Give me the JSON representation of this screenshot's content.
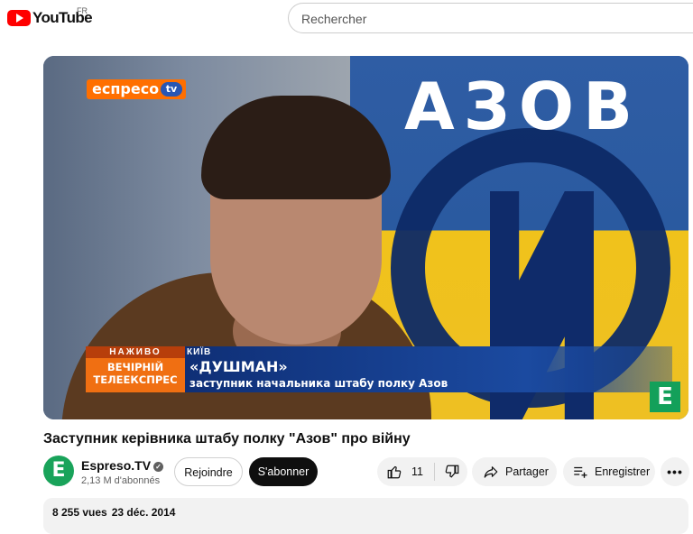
{
  "header": {
    "logo_text": "YouTube",
    "region": "FR",
    "search_placeholder": "Rechercher"
  },
  "player": {
    "brand_tag": "еспресо",
    "brand_tag_tv": "tv",
    "flag_text": "АЗОВ",
    "lower_third": {
      "live_label": "НАЖИВО",
      "show_name_line1": "ВЕЧІРНІЙ",
      "show_name_line2": "ТЕЛЕЕКСПРЕС",
      "city": "КИЇВ",
      "guest_name": "«ДУШМАН»",
      "guest_role": "заступник начальника штабу полку Азов"
    },
    "corner_logo": "Е"
  },
  "video": {
    "title": "Заступник керівника штабу полку \"Азов\" про війну",
    "views": "8 255 vues",
    "date": "23 déc. 2014"
  },
  "channel": {
    "avatar_letter": "Е",
    "name": "Espreso.TV",
    "subscribers": "2,13 M d'abonnés"
  },
  "actions": {
    "join_label": "Rejoindre",
    "subscribe_label": "S'abonner",
    "like_count": "11",
    "share_label": "Partager",
    "save_label": "Enregistrer",
    "more_label": "•••"
  },
  "colors": {
    "youtube_red": "#ff0000",
    "espreso_orange": "#f06f12",
    "espreso_green": "#19a35a",
    "azov_blue": "#0d2a66",
    "flag_yellow": "#f0c21b"
  }
}
